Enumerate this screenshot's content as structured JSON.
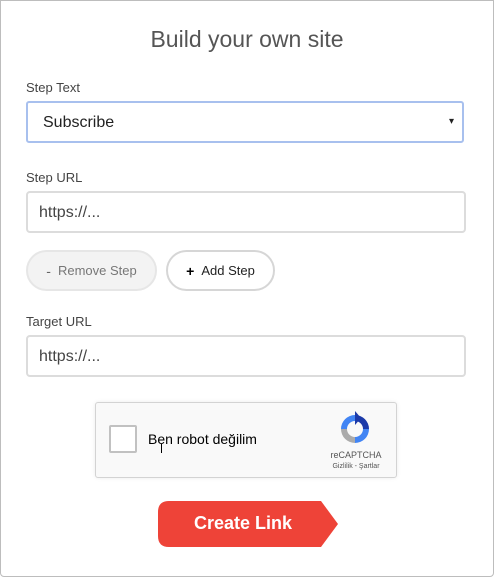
{
  "title": "Build your own site",
  "step_text": {
    "label": "Step Text",
    "selected": "Subscribe",
    "arrow": "▾"
  },
  "step_url": {
    "label": "Step URL",
    "placeholder": "https://..."
  },
  "buttons": {
    "remove_symbol": "-",
    "remove_label": "Remove Step",
    "add_symbol": "+",
    "add_label": "Add Step"
  },
  "target_url": {
    "label": "Target URL",
    "placeholder": "https://..."
  },
  "captcha": {
    "label": "Ben robot değilim",
    "brand": "reCAPTCHA",
    "terms": "Gizlilik - Şartlar"
  },
  "cta": {
    "label": "Create Link",
    "color": "#ee4338"
  }
}
